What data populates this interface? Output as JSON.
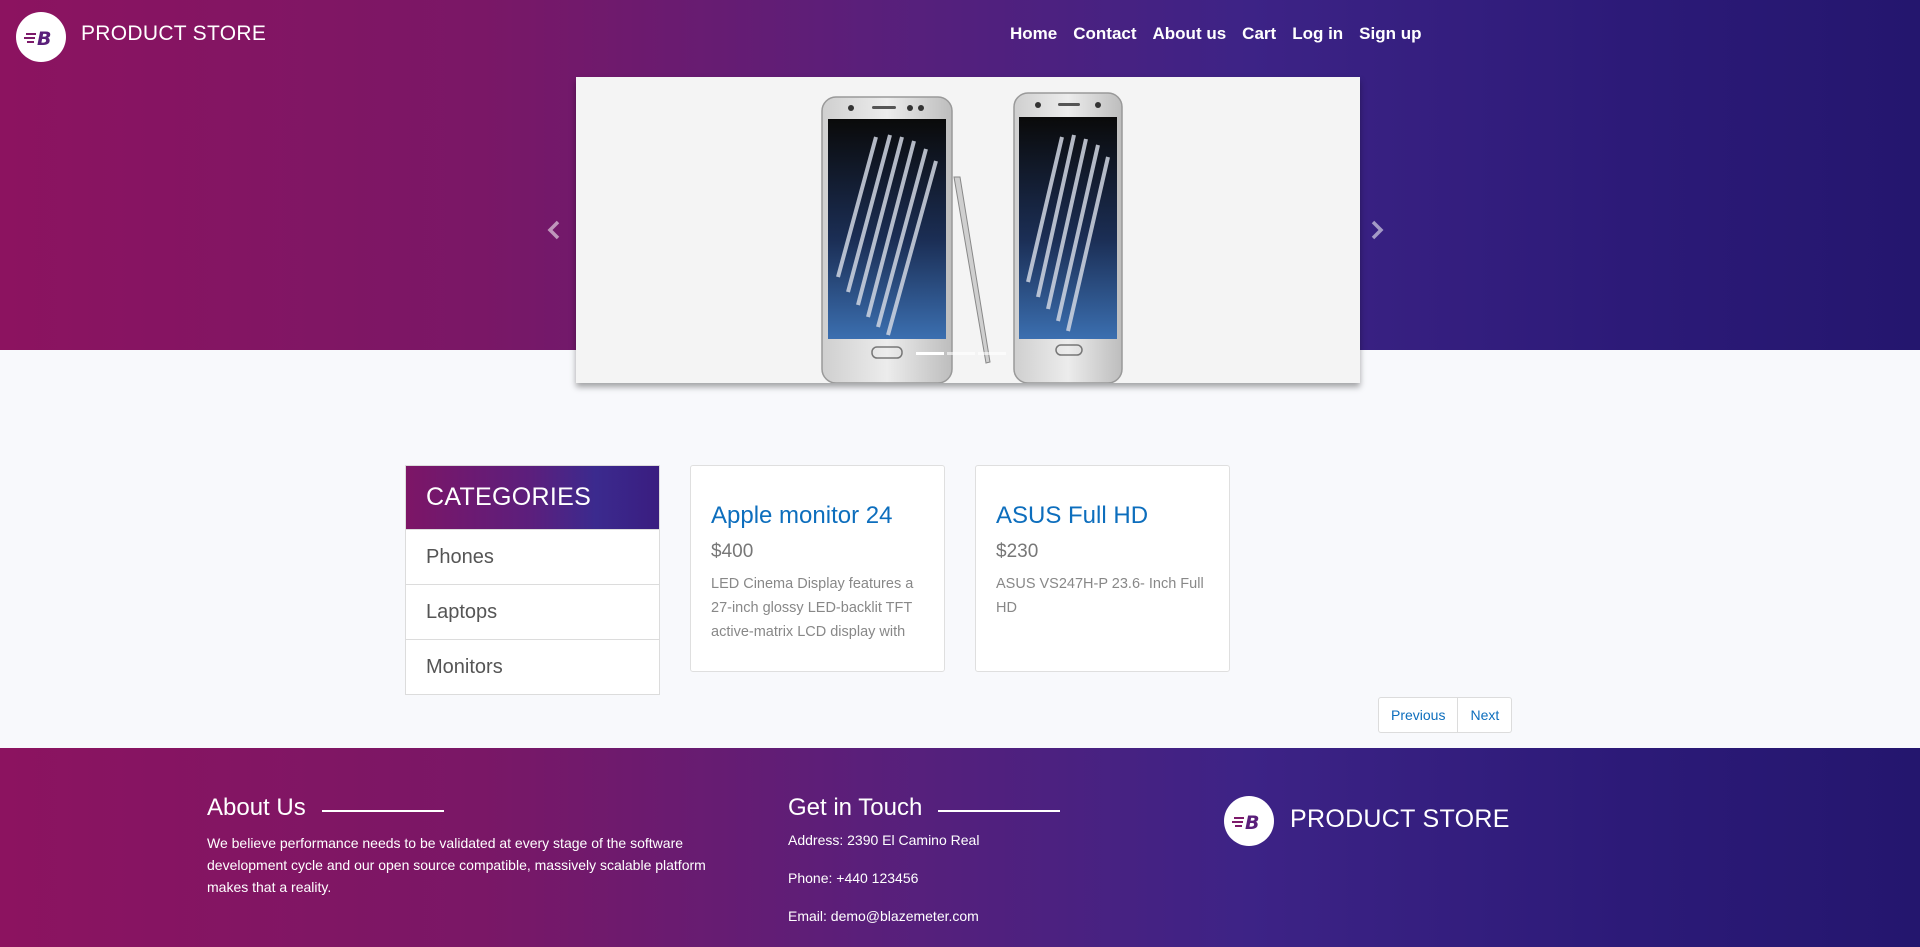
{
  "header": {
    "brand": "PRODUCT STORE",
    "logo_icon": "blazemeter-logo-icon",
    "nav": [
      {
        "label": "Home"
      },
      {
        "label": "Contact"
      },
      {
        "label": "About us"
      },
      {
        "label": "Cart"
      },
      {
        "label": "Log in"
      },
      {
        "label": "Sign up"
      }
    ]
  },
  "carousel": {
    "image": "samsung-galaxy-note-phones-image",
    "prev_icon": "chevron-left-icon",
    "next_icon": "chevron-right-icon",
    "slides": 3,
    "active_slide": 1
  },
  "categories": {
    "title": "CATEGORIES",
    "items": [
      {
        "label": "Phones"
      },
      {
        "label": "Laptops"
      },
      {
        "label": "Monitors"
      }
    ]
  },
  "products": [
    {
      "title": "Apple monitor 24",
      "price": "$400",
      "description": "LED Cinema Display features a 27-inch glossy LED-backlit TFT active-matrix LCD display with"
    },
    {
      "title": "ASUS Full HD",
      "price": "$230",
      "description": "ASUS VS247H-P 23.6- Inch Full HD"
    }
  ],
  "pagination": {
    "previous": "Previous",
    "next": "Next"
  },
  "footer": {
    "about_title": "About Us",
    "about_text": "We believe performance needs to be validated at every stage of the software development cycle and our open source compatible, massively scalable platform makes that a reality.",
    "touch_title": "Get in Touch",
    "address": "Address: 2390 El Camino Real",
    "phone": "Phone: +440 123456",
    "email": "Email: demo@blazemeter.com",
    "brand": "PRODUCT STORE"
  },
  "colors": {
    "gradient_start": "#8c1360",
    "gradient_end": "#24166e",
    "link_blue": "#0d6ebd"
  }
}
